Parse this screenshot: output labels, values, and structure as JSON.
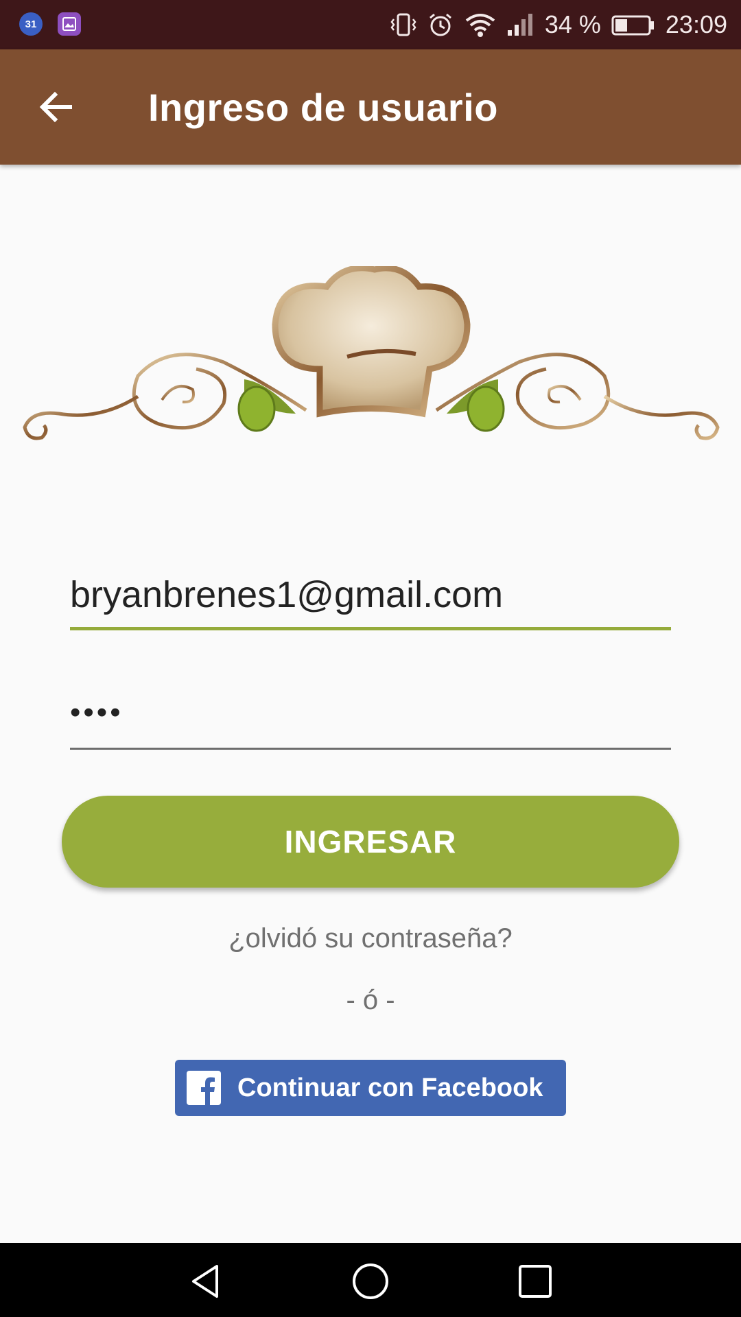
{
  "status_bar": {
    "battery_percent": "34 %",
    "time": "23:09",
    "app_icons": [
      "calendar-icon",
      "gallery-icon"
    ],
    "calendar_day": "31"
  },
  "app_bar": {
    "title": "Ingreso de usuario",
    "back_icon": "arrow-back-icon"
  },
  "form": {
    "email_value": "bryanbrenes1@gmail.com",
    "password_mask": "••••",
    "accent_color": "#95ab3b"
  },
  "actions": {
    "login_label": "INGRESAR",
    "forgot_label": "¿olvidó su contraseña?",
    "or_separator": "- ó -",
    "facebook_label": "Continuar con Facebook"
  },
  "colors": {
    "app_bar": "#7f4f30",
    "status_bar": "#3e1719",
    "button": "#97ad3c",
    "facebook": "#4267b2"
  }
}
